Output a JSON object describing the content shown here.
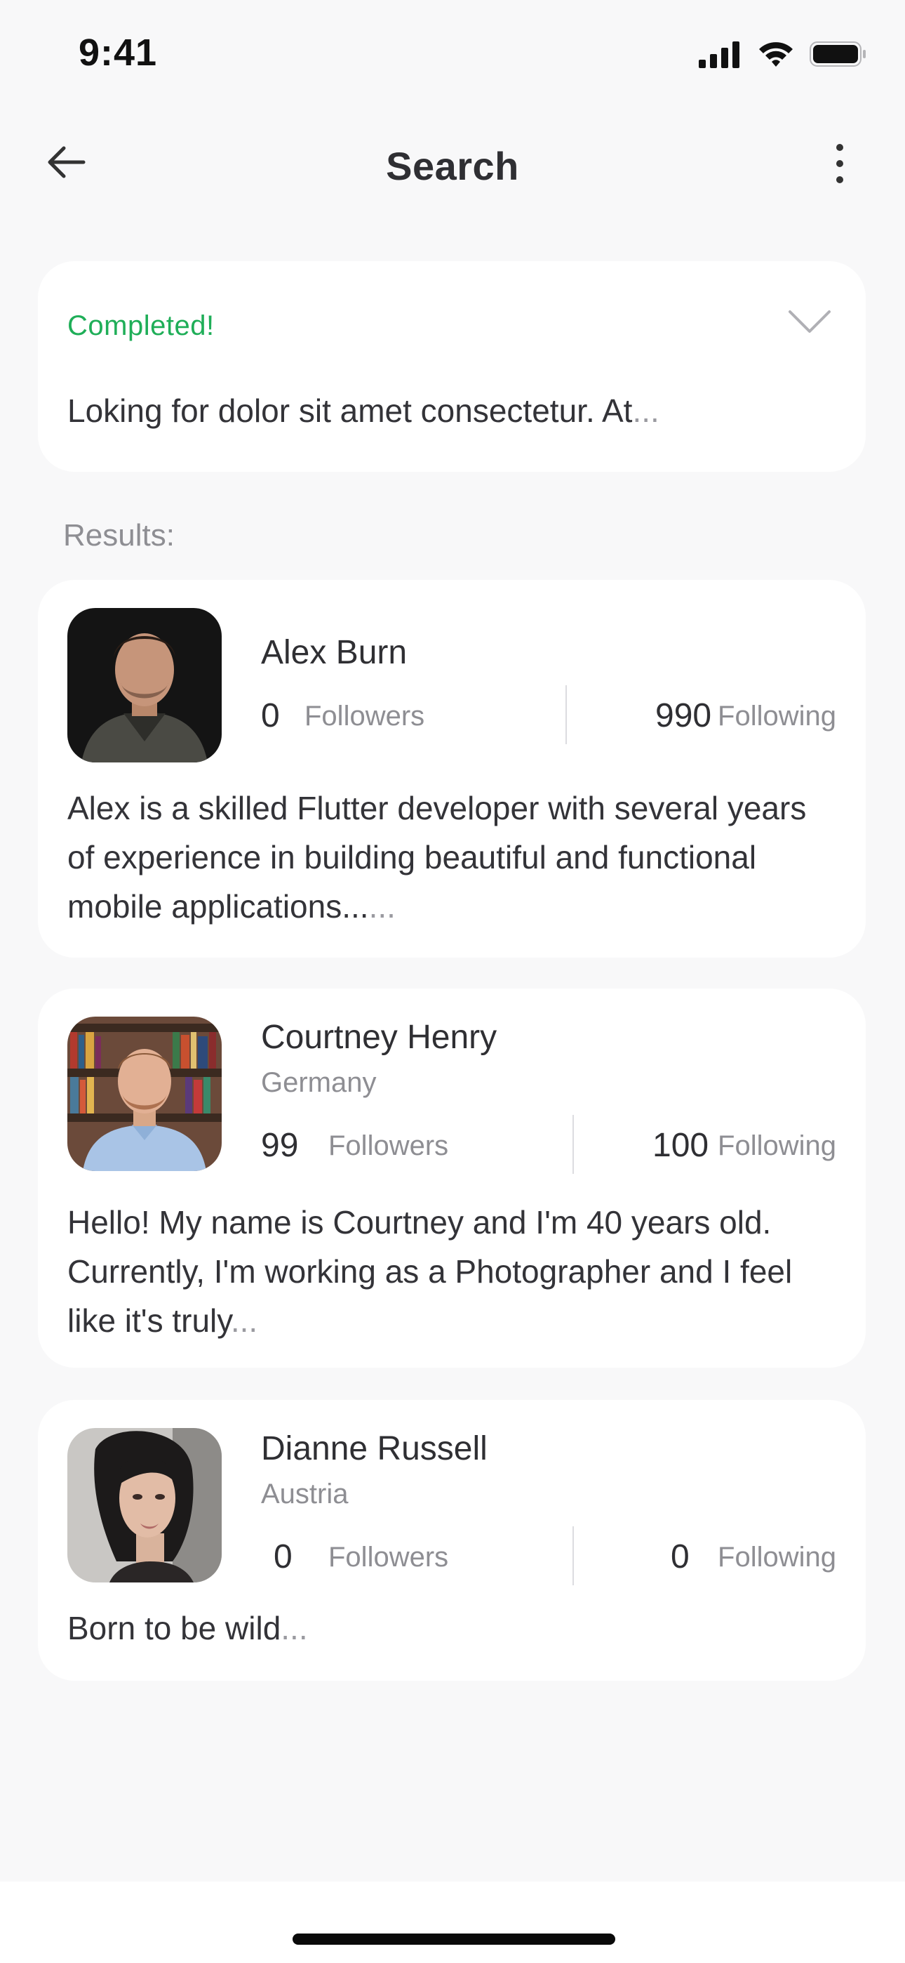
{
  "status_bar": {
    "time": "9:41",
    "icons": [
      "cellular-signal-icon",
      "wifi-icon",
      "battery-icon"
    ]
  },
  "nav": {
    "title": "Search",
    "back_icon": "arrow-left-icon",
    "more_icon": "vertical-dots-icon"
  },
  "search": {
    "status": "Completed!",
    "query": "Loking for dolor sit amet consectetur. At",
    "query_ellipsis": "...",
    "expand_icon": "chevron-down-icon"
  },
  "results": {
    "label": "Results:",
    "items": [
      {
        "name": "Alex Burn",
        "country": "",
        "followers_count": "0",
        "followers_label": "Followers",
        "following_count": "990",
        "following_label": "Following",
        "bio": "Alex is a skilled Flutter developer with several years of experience in building beautiful and functional mobile applications...",
        "bio_ellipsis": "...",
        "avatar": "man-dark-sweater-photo"
      },
      {
        "name": "Courtney Henry",
        "country": "Germany",
        "followers_count": "99",
        "followers_label": "Followers",
        "following_count": "100",
        "following_label": "Following",
        "bio": "Hello! My name is Courtney and I'm 40 years old. Currently, I'm working as a Photographer and I feel like it's truly",
        "bio_ellipsis": "...",
        "avatar": "man-bookshelf-photo"
      },
      {
        "name": "Dianne Russell",
        "country": "Austria",
        "followers_count": "0",
        "followers_label": "Followers",
        "following_count": "0",
        "following_label": "Following",
        "bio": "Born to be wild",
        "bio_ellipsis": "...",
        "avatar": "woman-portrait-photo"
      }
    ]
  },
  "colors": {
    "accent_green": "#1fae58",
    "background": "#f8f8f9",
    "card": "#ffffff",
    "text_primary": "#333338",
    "text_secondary": "#8e8e93"
  }
}
